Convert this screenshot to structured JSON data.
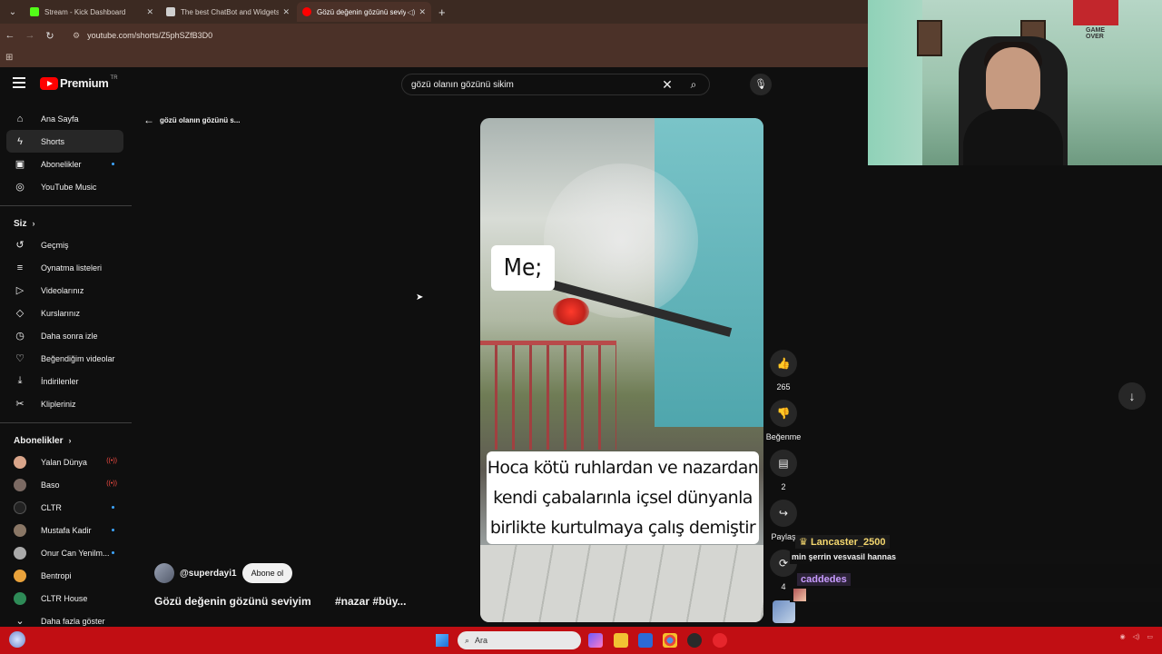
{
  "browser": {
    "tabs": [
      {
        "label": "Stream - Kick Dashboard",
        "favicon_color": "#53fc18"
      },
      {
        "label": "The best ChatBot and Widgets",
        "favicon_color": "#cfcfcf"
      },
      {
        "label": "Gözü değenin gözünü seviy",
        "favicon_color": "#ff0000"
      }
    ],
    "url": "youtube.com/shorts/Z5phSZfB3D0"
  },
  "header": {
    "logo_text": "Premium",
    "country_code": "TR",
    "search_value": "gözü olanın gözünü sikim"
  },
  "sidebar": {
    "main": [
      {
        "label": "Ana Sayfa",
        "icon": "home-icon",
        "glyph": "⌂"
      },
      {
        "label": "Shorts",
        "icon": "shorts-icon",
        "glyph": "ϟ"
      },
      {
        "label": "Abonelikler",
        "icon": "subscriptions-icon",
        "glyph": "▣"
      },
      {
        "label": "YouTube Music",
        "icon": "music-icon",
        "glyph": "◎"
      }
    ],
    "you_heading": "Siz",
    "you": [
      {
        "label": "Geçmiş",
        "icon": "history-icon",
        "glyph": "↺"
      },
      {
        "label": "Oynatma listeleri",
        "icon": "playlists-icon",
        "glyph": "≡"
      },
      {
        "label": "Videolarınız",
        "icon": "your-videos-icon",
        "glyph": "▷"
      },
      {
        "label": "Kurslarınız",
        "icon": "courses-icon",
        "glyph": "◇"
      },
      {
        "label": "Daha sonra izle",
        "icon": "watch-later-icon",
        "glyph": "◷"
      },
      {
        "label": "Beğendiğim videolar",
        "icon": "liked-icon",
        "glyph": "♡"
      },
      {
        "label": "İndirilenler",
        "icon": "downloads-icon",
        "glyph": "⤓"
      },
      {
        "label": "Klipleriniz",
        "icon": "clips-icon",
        "glyph": "✂"
      }
    ],
    "subs_heading": "Abonelikler",
    "subscriptions": [
      {
        "label": "Yalan Dünya",
        "color": "#d9a58a",
        "badge": "live"
      },
      {
        "label": "Baso",
        "color": "#7b6a63",
        "badge": "live"
      },
      {
        "label": "CLTR",
        "color": "#222222",
        "badge": "dot"
      },
      {
        "label": "Mustafa Kadir",
        "color": "#8a7766",
        "badge": "dot"
      },
      {
        "label": "Onur Can Yenilm...",
        "color": "#aaaaaa",
        "badge": "dot"
      },
      {
        "label": "Bentropi",
        "color": "#e9a23b",
        "badge": ""
      },
      {
        "label": "CLTR House",
        "color": "#2e8b57",
        "badge": ""
      }
    ],
    "show_more": "Daha fazla göster"
  },
  "main": {
    "back_label": "gözü olanın gözünü s...",
    "short": {
      "overlay_top": "Me;",
      "caption_lines": [
        "Hoca kötü ruhlardan ve nazardan",
        "kendi çabalarınla içsel dünyanla",
        "birlikte kurtulmaya çalış demiştir"
      ],
      "channel": "@superdayi1",
      "subscribe": "Abone ol",
      "title": "Gözü değenin gözünü seviyim",
      "tags": "#nazar #büy..."
    },
    "actions": {
      "likes": "265",
      "dislike_label": "Beğenme",
      "comments": "2",
      "share_label": "Paylaş",
      "remix_count": "4"
    }
  },
  "chat": {
    "user1": "Lancaster_2500",
    "message1": "min şerrin vesvasil hannas",
    "user2": "caddedes"
  },
  "taskbar": {
    "search_placeholder": "Ara"
  }
}
